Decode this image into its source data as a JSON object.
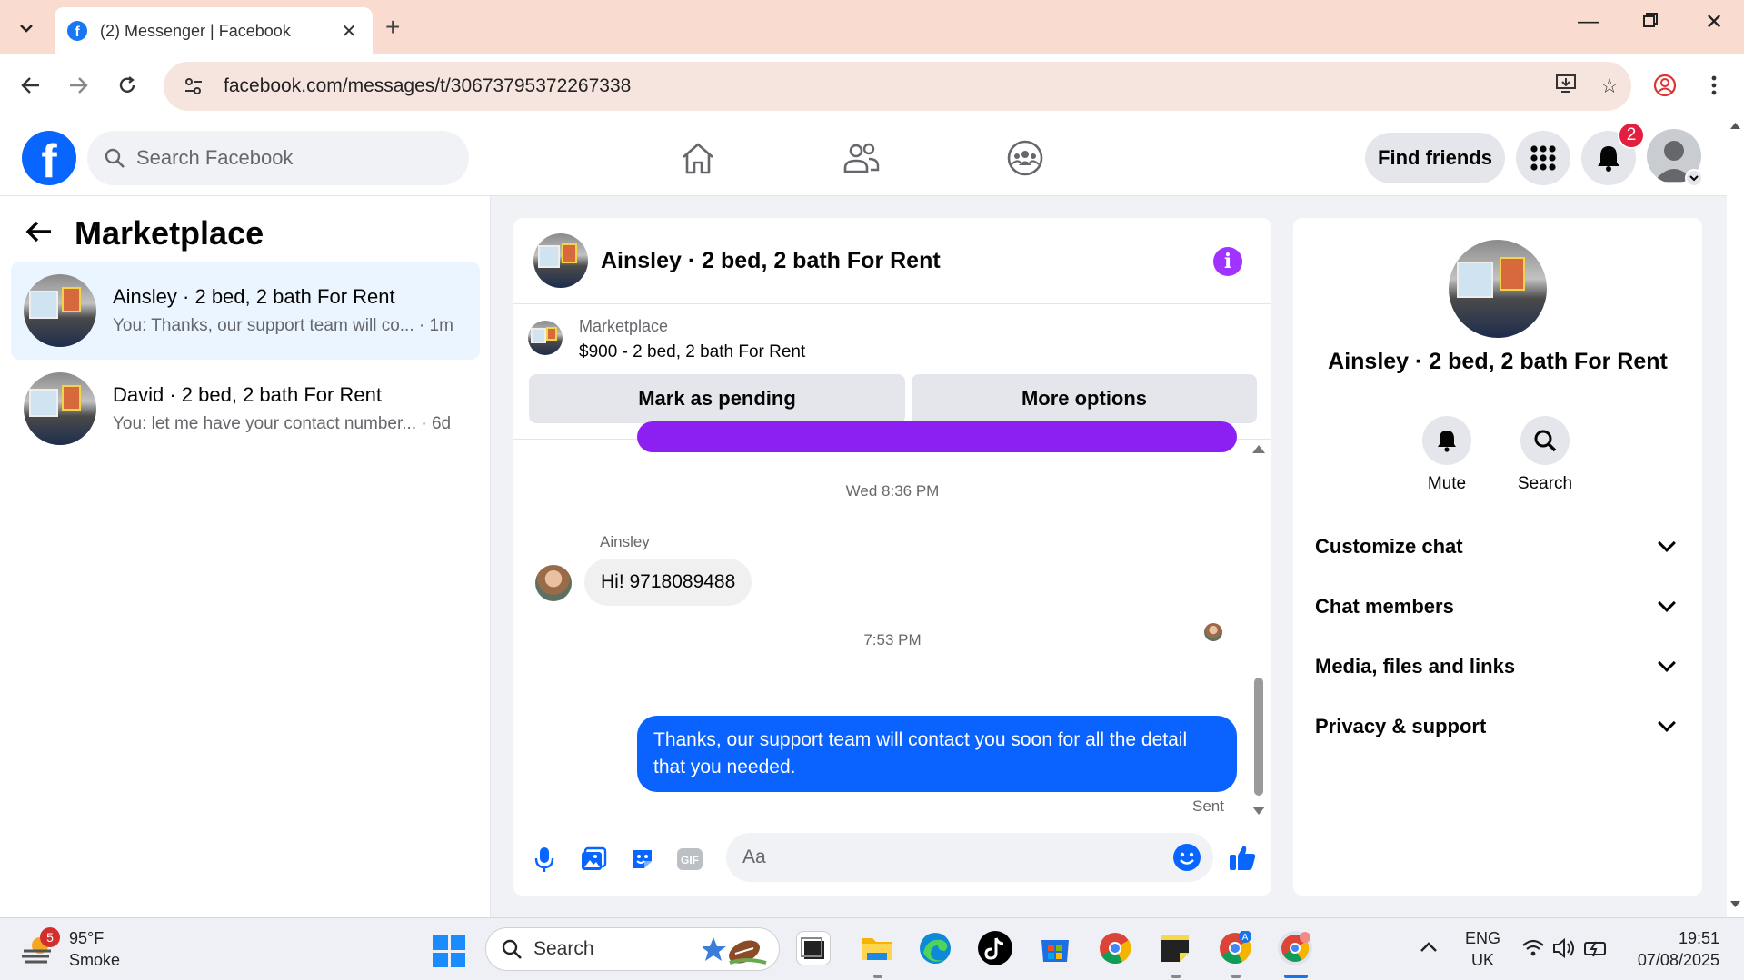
{
  "browser": {
    "tab_title": "(2) Messenger | Facebook",
    "url": "facebook.com/messages/t/30673795372267338"
  },
  "fb": {
    "search_placeholder": "Search Facebook",
    "find_friends": "Find friends",
    "notifications_count": "2"
  },
  "left_panel": {
    "title": "Marketplace",
    "conversations": [
      {
        "name": "Ainsley · 2 bed, 2 bath For Rent",
        "preview": "You: Thanks, our support team will co... · 1m",
        "active": true
      },
      {
        "name": "David · 2 bed, 2 bath For Rent",
        "preview": "You: let me have your contact number... · 6d",
        "active": false
      }
    ]
  },
  "chat": {
    "title": "Ainsley · 2 bed, 2 bath For Rent",
    "listing_label": "Marketplace",
    "listing_price": "$900 - 2 bed, 2 bath For Rent",
    "mark_pending": "Mark as pending",
    "more_options": "More options",
    "timestamp1": "Wed 8:36 PM",
    "sender_name": "Ainsley",
    "incoming_message": "Hi! 9718089488",
    "timestamp2": "7:53 PM",
    "outgoing_message": "Thanks, our support team will contact you soon for all the detail that you needed.",
    "sent_status": "Sent",
    "composer_placeholder": "Aa"
  },
  "right_panel": {
    "name": "Ainsley · 2 bed, 2 bath For Rent",
    "mute_label": "Mute",
    "search_label": "Search",
    "sections": [
      "Customize chat",
      "Chat members",
      "Media, files and links",
      "Privacy & support"
    ]
  },
  "taskbar": {
    "weather_badge": "5",
    "temperature": "95°F",
    "condition": "Smoke",
    "search_label": "Search",
    "lang1": "ENG",
    "lang2": "UK",
    "time": "19:51",
    "date": "07/08/2025"
  },
  "colors": {
    "fb_blue": "#0866ff",
    "outgoing_bubble": "#0a62ff",
    "purple_accent": "#a033ff",
    "active_row": "#ebf5ff",
    "tabbar": "#fadbd0"
  }
}
